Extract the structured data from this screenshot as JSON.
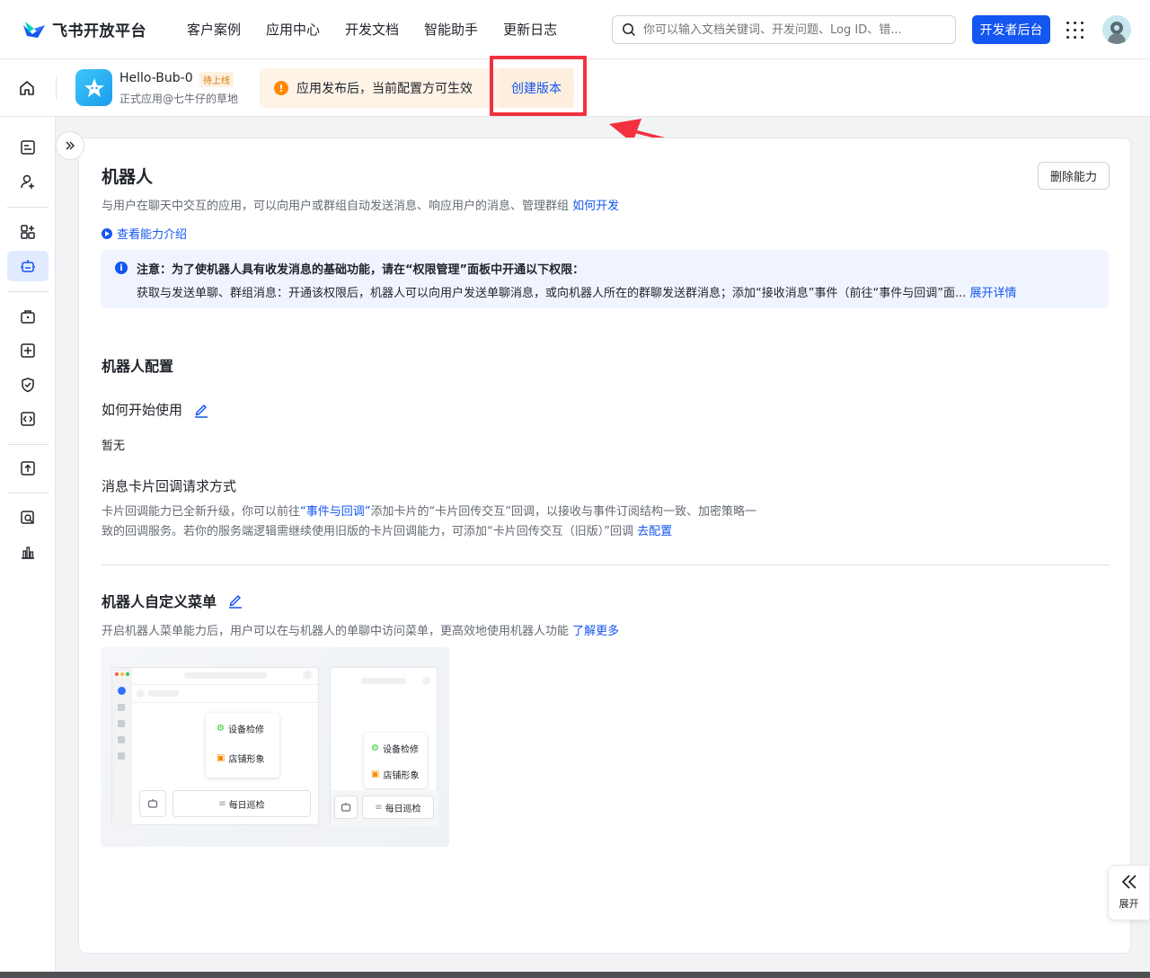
{
  "brand": {
    "name": "飞书开放平台",
    "primary": "#1456f0",
    "accent_warning": "#ff8800",
    "highlight": "#f3303f"
  },
  "nav": {
    "items": [
      "客户案例",
      "应用中心",
      "开发文档",
      "智能助手",
      "更新日志"
    ]
  },
  "search": {
    "placeholder": "你可以输入文档关键词、开发问题、Log ID、错..."
  },
  "header": {
    "dev_console": "开发者后台"
  },
  "app": {
    "name": "Hello-Bub-0",
    "status": "待上线",
    "owner": "正式应用@七牛仔的草地"
  },
  "notice": {
    "text": "应用发布后，当前配置方可生效",
    "action": "创建版本"
  },
  "page": {
    "title": "机器人",
    "delete": "删除能力",
    "desc": "与用户在聊天中交互的应用，可以向用户或群组自动发送消息、响应用户的消息、管理群组",
    "desc_link": "如何开发",
    "intro_link": "查看能力介绍",
    "info_title": "注意：为了使机器人具有收发消息的基础功能，请在“权限管理”面板中开通以下权限：",
    "info_body": "获取与发送单聊、群组消息：开通该权限后，机器人可以向用户发送单聊消息，或向机器人所在的群聊发送群消息；添加“接收消息”事件（前往“事件与回调”面...",
    "info_more": "展开详情",
    "config_title": "机器人配置",
    "howto_title": "如何开始使用",
    "howto_value": "暂无",
    "callback_title": "消息卡片回调请求方式",
    "callback_p1a": "卡片回调能力已全新升级，你可以前往",
    "callback_p1link": "“事件与回调”",
    "callback_p1b": "添加卡片的“卡片回传交互”回调，以接收与事件订阅结构一致、加密策略一",
    "callback_p2": "致的回调服务。若你的服务端逻辑需继续使用旧版的卡片回调能力，可添加“卡片回传交互（旧版）”回调 ",
    "callback_link": "去配置",
    "menu_title": "机器人自定义菜单",
    "menu_desc": "开启机器人菜单能力后，用户可以在与机器人的单聊中访问菜单，更高效地使用机器人功能 ",
    "menu_link": "了解更多"
  },
  "illustration": {
    "item1": "设备检修",
    "item2": "店铺形象",
    "item3": "每日巡检"
  },
  "float": {
    "label": "展开"
  }
}
